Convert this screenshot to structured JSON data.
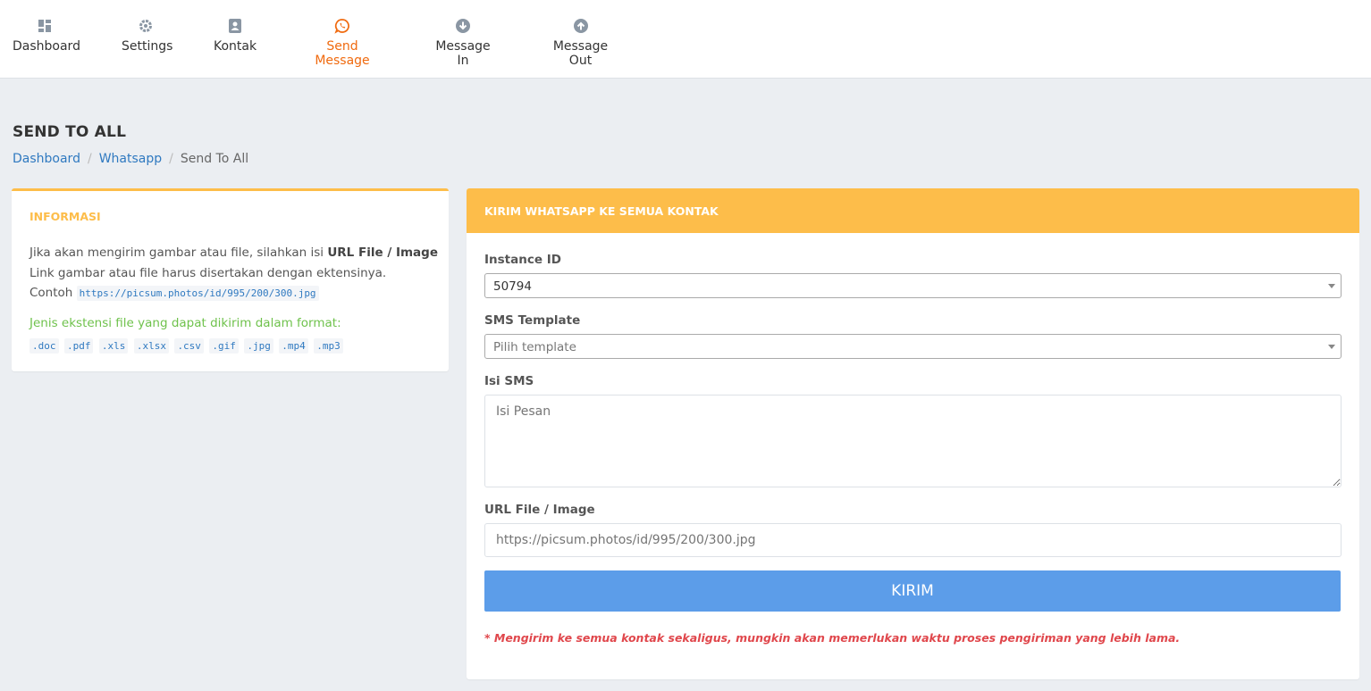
{
  "nav": {
    "items": [
      {
        "label": "Dashboard",
        "icon": "dashboard-icon"
      },
      {
        "label": "Settings",
        "icon": "gear-icon"
      },
      {
        "label": "Kontak",
        "icon": "contact-icon"
      },
      {
        "label": "Send Message",
        "icon": "whatsapp-icon",
        "active": true
      },
      {
        "label": "Message In",
        "icon": "arrow-down-circle-icon"
      },
      {
        "label": "Message Out",
        "icon": "arrow-up-circle-icon"
      }
    ]
  },
  "page": {
    "title": "SEND TO ALL",
    "breadcrumb": [
      "Dashboard",
      "Whatsapp",
      "Send To All"
    ]
  },
  "info": {
    "title": "INFORMASI",
    "line1_prefix": "Jika akan mengirim gambar atau file, silahkan isi ",
    "line1_bold": "URL File / Image",
    "line2": "Link gambar atau file harus disertakan dengan ektensinya.",
    "line3_prefix": "Contoh",
    "example_url": "https://picsum.photos/id/995/200/300.jpg",
    "formats_label": "Jenis ekstensi file yang dapat dikirim dalam format:",
    "extensions": [
      ".doc",
      ".pdf",
      ".xls",
      ".xlsx",
      ".csv",
      ".gif",
      ".jpg",
      ".mp4",
      ".mp3"
    ]
  },
  "form": {
    "header": "KIRIM WHATSAPP KE SEMUA KONTAK",
    "instance_label": "Instance ID",
    "instance_value": "50794",
    "template_label": "SMS Template",
    "template_placeholder": "Pilih template",
    "isi_label": "Isi SMS",
    "isi_placeholder": "Isi Pesan",
    "url_label": "URL File / Image",
    "url_placeholder": "https://picsum.photos/id/995/200/300.jpg",
    "submit_label": "KIRIM",
    "note": "* Mengirim ke semua kontak sekaligus, mungkin akan memerlukan waktu proses pengiriman yang lebih lama."
  },
  "colors": {
    "accent": "#fdbd4a",
    "active_nav": "#f06a0f",
    "link": "#2f79c0",
    "button": "#5c9de9",
    "warning": "#e0474c",
    "success": "#6fc24c"
  }
}
